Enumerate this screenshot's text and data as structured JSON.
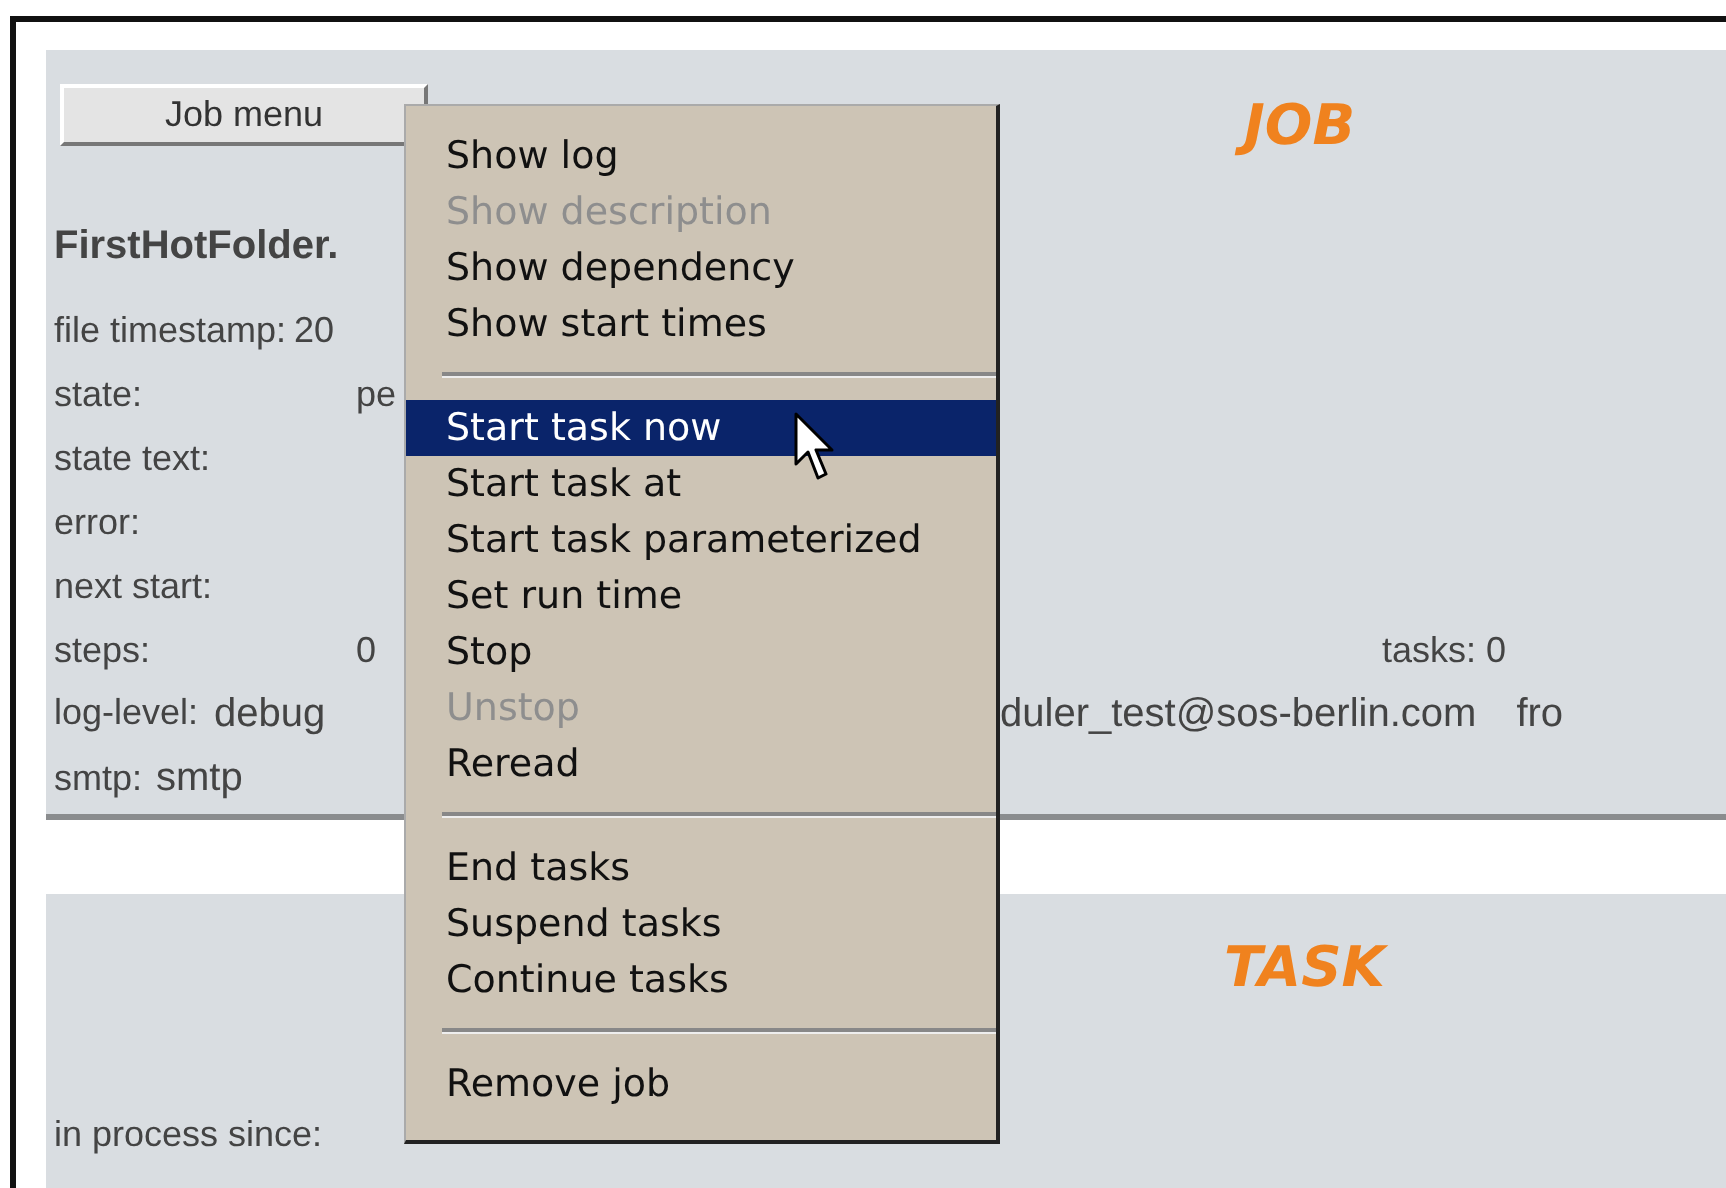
{
  "job_menu_button": {
    "label": "Job menu"
  },
  "job_panel": {
    "heading": "JOB",
    "job_name": "FirstHotFolder.",
    "fields": [
      {
        "label": "file timestamp:",
        "value": "20"
      },
      {
        "label": "state:",
        "value": "pe"
      },
      {
        "label": "state text:"
      },
      {
        "label": "error:"
      },
      {
        "label": "next start:"
      }
    ],
    "steps": {
      "label": "steps:",
      "value": "0"
    },
    "tasks": "tasks: 0",
    "log_level": {
      "label": "log-level:",
      "value": "debug"
    },
    "mail_to": "duler_test@sos-berlin.com",
    "mail_from": "fro",
    "smtp": {
      "label": "smtp:",
      "value": "smtp"
    }
  },
  "task_panel": {
    "heading": "TASK",
    "in_process_since": "in process since:"
  },
  "context_menu": {
    "groups": [
      [
        {
          "label": "Show log",
          "disabled": false,
          "selected": false
        },
        {
          "label": "Show description",
          "disabled": true,
          "selected": false
        },
        {
          "label": "Show dependency",
          "disabled": false,
          "selected": false
        },
        {
          "label": "Show start times",
          "disabled": false,
          "selected": false
        }
      ],
      [
        {
          "label": "Start task now",
          "disabled": false,
          "selected": true
        },
        {
          "label": "Start task at",
          "disabled": false,
          "selected": false
        },
        {
          "label": "Start task parameterized",
          "disabled": false,
          "selected": false
        },
        {
          "label": "Set run time",
          "disabled": false,
          "selected": false
        },
        {
          "label": "Stop",
          "disabled": false,
          "selected": false
        },
        {
          "label": "Unstop",
          "disabled": true,
          "selected": false
        },
        {
          "label": "Reread",
          "disabled": false,
          "selected": false
        }
      ],
      [
        {
          "label": "End tasks",
          "disabled": false,
          "selected": false
        },
        {
          "label": "Suspend tasks",
          "disabled": false,
          "selected": false
        },
        {
          "label": "Continue tasks",
          "disabled": false,
          "selected": false
        }
      ],
      [
        {
          "label": "Remove job",
          "disabled": false,
          "selected": false
        }
      ]
    ]
  }
}
